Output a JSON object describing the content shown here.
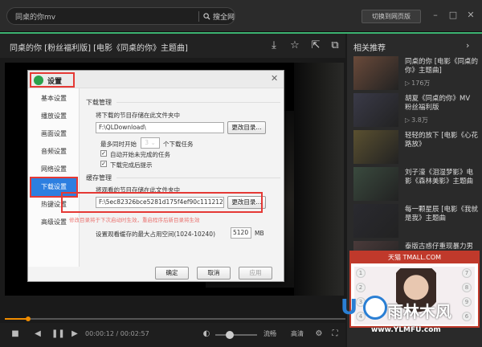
{
  "topbar": {
    "search_text": "同桌的你mv",
    "search_button": "搜全网",
    "switch_button": "切换到网页版",
    "window_buttons": [
      "min-icon",
      "max-icon",
      "close-icon"
    ]
  },
  "player": {
    "title": "同桌的你 [粉丝福利版] [电影《同桌的你》主题曲]",
    "title_icons": [
      "download-icon",
      "star-icon",
      "share-icon",
      "popout-icon",
      "fullscreen-icon"
    ],
    "time_current": "00:00:12",
    "time_separator": "/",
    "time_total": "00:02:57",
    "progress": 0.068,
    "volume": 0.35,
    "controls": {
      "quality_label": "流畅",
      "hd_label": "高清"
    }
  },
  "related": {
    "title": "相关推荐",
    "items": [
      {
        "title": "同桌的你 [电影《同桌的你》主题曲]",
        "views": "176万",
        "thumb": "#6a4a3a"
      },
      {
        "title": "胡夏《同桌的你》MV 粉丝福利版",
        "views": "3.8万",
        "thumb": "#3a3a48"
      },
      {
        "title": "轻轻的放下 [电影《心花路放》",
        "views": "",
        "thumb": "#5a5030"
      },
      {
        "title": "刘子濠《泪湿梦影》电影《森林美影》主题曲",
        "views": "",
        "thumb": "#3a4a3e"
      },
      {
        "title": "每一颗星辰 [电影《我就是我》主题曲",
        "views": "",
        "thumb": "#2a2a30"
      },
      {
        "title": "泰版古惑仔重现暴力男情节，泰国电影《黑帮",
        "views": "",
        "thumb": "#4a3a3a"
      }
    ]
  },
  "ad": {
    "header": "天猫 TMALL.COM",
    "left_numbers": [
      "1",
      "2",
      "3",
      "4"
    ],
    "right_numbers": [
      "7",
      "8",
      "9",
      "6"
    ]
  },
  "watermark": {
    "logo_letter": "U",
    "brand": "雨林木风",
    "url": "www.YLMFU.com"
  },
  "dialog": {
    "title": "设置",
    "nav": [
      "基本设置",
      "播放设置",
      "画面设置",
      "音频设置",
      "网络设置",
      "下载设置",
      "热键设置",
      "高级设置"
    ],
    "active_nav": "下载设置",
    "download": {
      "section_title": "下载管理",
      "save_label": "将下载的节目存储在此文件夹中",
      "path": "F:\\QLDownload\\",
      "change_button": "更改目录...",
      "max_tasks_prefix": "最多同时开始",
      "max_tasks_value": "3",
      "max_tasks_suffix": "个下载任务",
      "auto_start": "自动开始未完成的任务",
      "notify_done": "下载完成后提示"
    },
    "cache": {
      "section_title": "缓存管理",
      "save_label": "将观看的节目存储在此文件夹中",
      "path": "F:\\5ec82326bce5281d175f4ef90c111212\\",
      "change_button": "更改目录...",
      "note": "修改目录将于下次启动时生效，重启程序后新目录将生效",
      "space_label": "设置观看缓存的最大占用空间(1024-10240)",
      "space_value": "5120",
      "space_unit": "MB"
    },
    "buttons": {
      "ok": "确定",
      "cancel": "取消",
      "apply": "应用"
    }
  }
}
